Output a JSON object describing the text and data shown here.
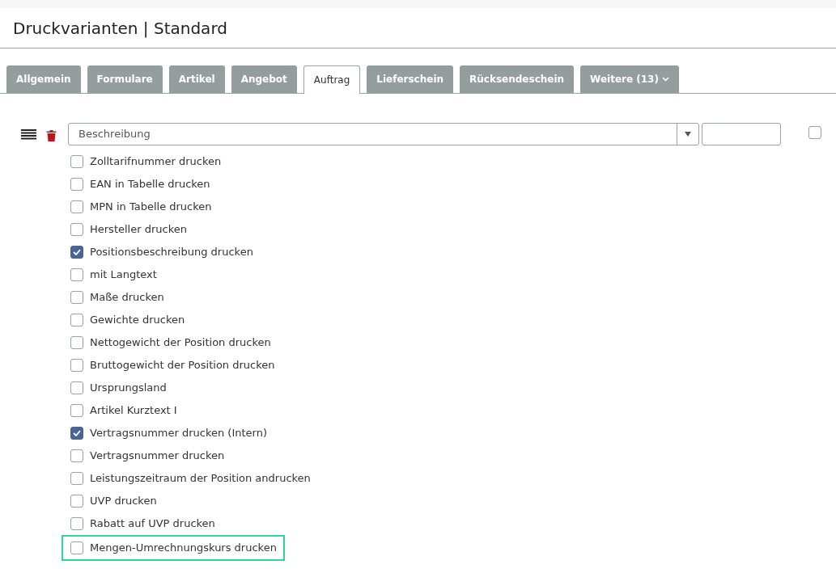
{
  "title": "Druckvarianten | Standard",
  "tabs": [
    {
      "label": "Allgemein",
      "selected": false
    },
    {
      "label": "Formulare",
      "selected": false
    },
    {
      "label": "Artikel",
      "selected": false
    },
    {
      "label": "Angebot",
      "selected": false
    },
    {
      "label": "Auftrag",
      "selected": true
    },
    {
      "label": "Lieferschein",
      "selected": false
    },
    {
      "label": "Rücksendeschein",
      "selected": false
    },
    {
      "label": "Weitere (13)",
      "selected": false,
      "kind": "dropdown"
    }
  ],
  "field_row": {
    "select_value": "Beschreibung",
    "checked": false
  },
  "options": [
    {
      "label": "Zolltarifnummer drucken",
      "checked": false
    },
    {
      "label": "EAN in Tabelle drucken",
      "checked": false
    },
    {
      "label": "MPN in Tabelle drucken",
      "checked": false
    },
    {
      "label": "Hersteller drucken",
      "checked": false
    },
    {
      "label": "Positionsbeschreibung drucken",
      "checked": true
    },
    {
      "label": "mit Langtext",
      "checked": false
    },
    {
      "label": "Maße drucken",
      "checked": false
    },
    {
      "label": "Gewichte drucken",
      "checked": false
    },
    {
      "label": "Nettogewicht der Position drucken",
      "checked": false
    },
    {
      "label": "Bruttogewicht der Position drucken",
      "checked": false
    },
    {
      "label": "Ursprungsland",
      "checked": false
    },
    {
      "label": "Artikel Kurztext I",
      "checked": false
    },
    {
      "label": "Vertragsnummer drucken (Intern)",
      "checked": true
    },
    {
      "label": "Vertragsnummer drucken",
      "checked": false
    },
    {
      "label": "Leistungszeitraum der Position andrucken",
      "checked": false
    },
    {
      "label": "UVP drucken",
      "checked": false
    },
    {
      "label": "Rabatt auf UVP drucken",
      "checked": false
    },
    {
      "label": "Mengen-Umrechnungskurs drucken",
      "checked": false,
      "highlighted": true
    }
  ]
}
